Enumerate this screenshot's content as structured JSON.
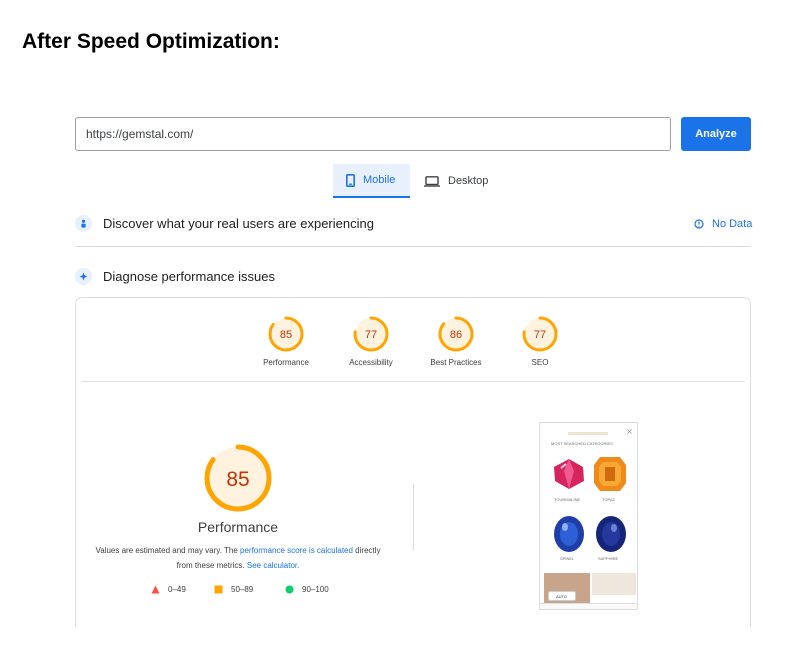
{
  "heading": "After Speed Optimization:",
  "search": {
    "url_value": "https://gemstal.com/",
    "analyze_label": "Analyze"
  },
  "tabs": [
    {
      "label": "Mobile",
      "active": true
    },
    {
      "label": "Desktop",
      "active": false
    }
  ],
  "crux": {
    "label": "Discover what your real users are experiencing",
    "status": "No Data"
  },
  "diagnose": {
    "label": "Diagnose performance issues"
  },
  "scores": [
    {
      "name": "Performance",
      "value": 85
    },
    {
      "name": "Accessibility",
      "value": 77
    },
    {
      "name": "Best Practices",
      "value": 86
    },
    {
      "name": "SEO",
      "value": 77
    }
  ],
  "performance": {
    "score": 85,
    "label": "Performance",
    "note_prefix": "Values are estimated and may vary. The ",
    "note_link1": "performance score is calculated",
    "note_middle": " directly from these metrics. ",
    "note_link2": "See calculator."
  },
  "legend": [
    {
      "range": "0–49",
      "color": "#ff4e42",
      "shape": "triangle"
    },
    {
      "range": "50–89",
      "color": "#ffa400",
      "shape": "square"
    },
    {
      "range": "90–100",
      "color": "#0cce6b",
      "shape": "circle"
    }
  ],
  "preview": {
    "heading": "MOST SEARCHED CATEGORIES",
    "products": [
      {
        "name": "TOURMALINE",
        "color": "#d6245f"
      },
      {
        "name": "TOPAZ",
        "color": "#ef8a1b"
      },
      {
        "name": "SPINEL",
        "color": "#1e3fa8"
      },
      {
        "name": "SAPPHIRE",
        "color": "#16257a"
      }
    ],
    "auto_label": "AUTO"
  },
  "colors": {
    "accent": "#1a73e8",
    "gauge_orange": "#ffa400",
    "score_text": "#c33300",
    "gauge_fill": "#fff3e0"
  }
}
